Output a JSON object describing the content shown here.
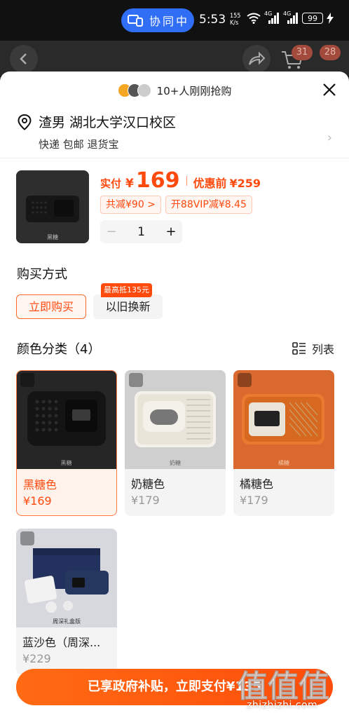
{
  "status_bar": {
    "pill_text": "协同中",
    "time": "5:53",
    "net_speed_value": "155",
    "net_speed_unit": "K/s",
    "signal_label_1": "4G",
    "signal_label_2": "4G",
    "battery": "99"
  },
  "header": {
    "badge_1": "31",
    "badge_2": "28"
  },
  "promo": {
    "text": "10+人刚刚抢购"
  },
  "address": {
    "line1": "渣男 湖北大学汉口校区",
    "line2": "快递 包邮 退货宝"
  },
  "product": {
    "thumb_caption": "黑糖",
    "price_label": "实付",
    "currency": "¥",
    "price": "169",
    "before_label": "优惠前",
    "before_price": "¥259",
    "discount_chip": "共减¥90 >",
    "vip_chip": "开88VIP减¥8.45",
    "quantity": "1",
    "minus": "−",
    "plus": "+"
  },
  "purchase": {
    "title": "购买方式",
    "buy_now": "立即购买",
    "trade_in": "以旧换新",
    "trade_in_tag": "最高抵135元"
  },
  "colors": {
    "title": "颜色分类（4）",
    "list_label": "列表",
    "items": [
      {
        "name": "黑糖色",
        "price": "¥169",
        "caption": "黑糖",
        "selected": true
      },
      {
        "name": "奶糖色",
        "price": "¥179",
        "caption": "奶糖"
      },
      {
        "name": "橘糖色",
        "price": "¥179",
        "caption": "橘糖"
      },
      {
        "name": "蓝沙色（周深...",
        "price": "¥229",
        "caption": "周深礼盒版"
      }
    ]
  },
  "footer": {
    "pay_button": "已享政府补贴，立即支付¥135"
  },
  "watermark": {
    "text": "zhizhizhi.com",
    "logo_text": "值值值"
  },
  "theme": {
    "accent": "#ff4a0e",
    "pill_blue": "#2f6ef5"
  }
}
